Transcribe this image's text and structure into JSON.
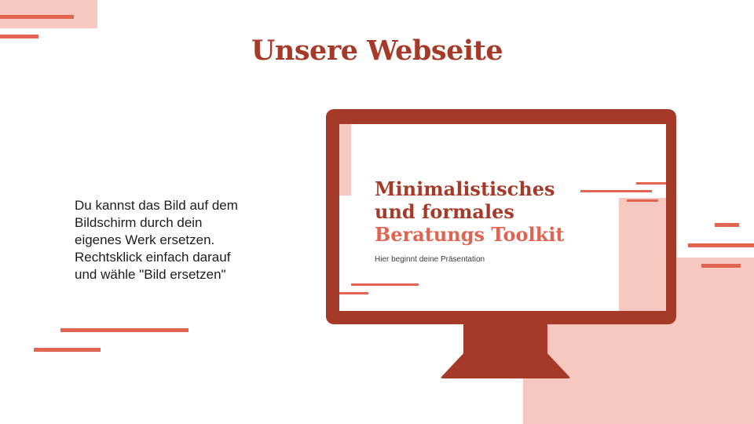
{
  "slide": {
    "title": "Unsere Webseite",
    "body_lines": [
      "Du kannst das Bild auf dem",
      "Bildschirm durch dein",
      "eigenes Werk ersetzen.",
      "Rechtsklick einfach darauf",
      "und wähle \"Bild ersetzen\""
    ]
  },
  "screen": {
    "title_line1": "Minimalistisches",
    "title_line2": "und formales",
    "title_line3": "Beratungs Toolkit",
    "subtitle": "Hier beginnt deine Präsentation"
  },
  "colors": {
    "dark_red": "#a63a29",
    "coral": "#e06450",
    "pink": "#f6c8c0",
    "background": "#ffffff"
  }
}
